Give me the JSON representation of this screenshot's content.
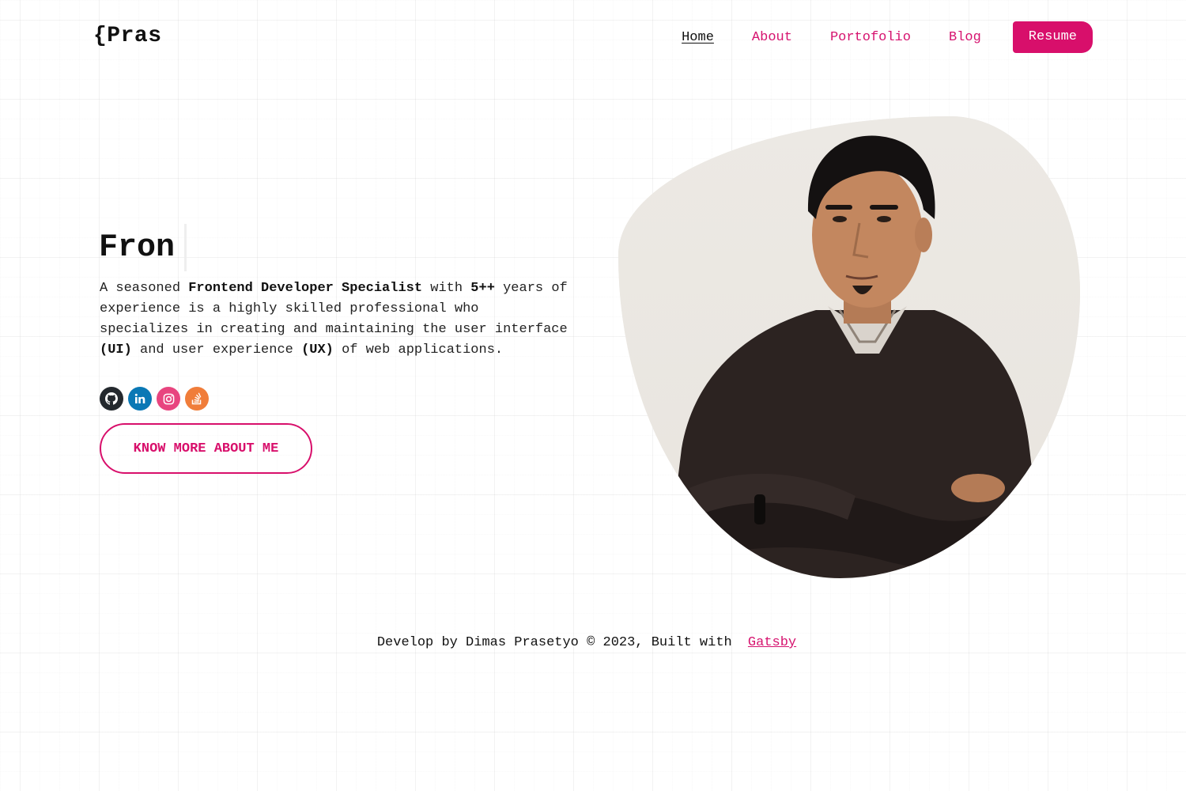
{
  "header": {
    "logo": "{Pras",
    "nav": [
      {
        "label": "Home",
        "active": true
      },
      {
        "label": "About",
        "active": false
      },
      {
        "label": "Portofolio",
        "active": false
      },
      {
        "label": "Blog",
        "active": false
      }
    ],
    "resume_label": "Resume"
  },
  "hero": {
    "title": "Fron",
    "intro": {
      "p1": "A seasoned ",
      "b1": "Frontend Developer Specialist",
      "p2": " with ",
      "b2": "5++",
      "p3": " years of experience is a highly skilled professional who specializes in creating and maintaining the user interface ",
      "b3": "(UI)",
      "p4": " and user experience ",
      "b4": "(UX)",
      "p5": " of web applications."
    },
    "socials": [
      {
        "icon": "github-icon",
        "color": "#24292e"
      },
      {
        "icon": "linkedin-icon",
        "color": "#0a78b5"
      },
      {
        "icon": "instagram-icon",
        "color": "#e8457f"
      },
      {
        "icon": "stackoverflow-icon",
        "color": "#f07d3a"
      }
    ],
    "cta_label": "KNOW MORE ABOUT ME",
    "portrait": "portrait-photo"
  },
  "footer": {
    "text": "Develop by Dimas Prasetyo © 2023, Built with",
    "link": "Gatsby"
  },
  "colors": {
    "accent": "#d80f6b",
    "text": "#111111"
  }
}
